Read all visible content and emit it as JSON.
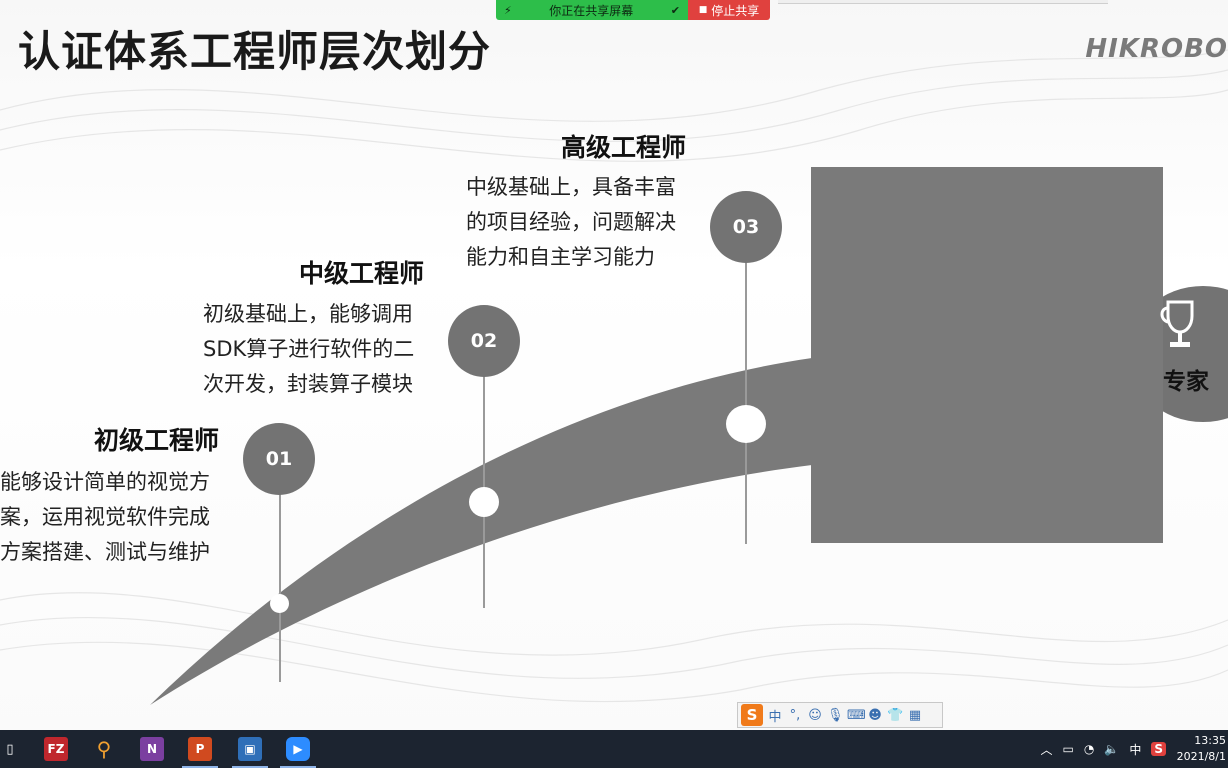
{
  "share_banner": {
    "status_text": "你正在共享屏幕",
    "stop_label": "停止共享"
  },
  "slide": {
    "title": "认证体系工程师层次划分",
    "logo": "HIKROBO",
    "levels": [
      {
        "number": "01",
        "title": "初级工程师",
        "desc": [
          "能够设计简单的视觉方",
          "案，运用视觉软件完成",
          "方案搭建、测试与维护"
        ]
      },
      {
        "number": "02",
        "title": "中级工程师",
        "desc": [
          "初级基础上，能够调用",
          "SDK算子进行软件的二",
          "次开发，封装算子模块"
        ]
      },
      {
        "number": "03",
        "title": "高级工程师",
        "desc": [
          "中级基础上，具备丰富",
          "的项目经验，问题解决",
          "能力和自主学习能力"
        ]
      }
    ],
    "expert_label": "专家"
  },
  "ime": {
    "lang": "中",
    "punct": "°,"
  },
  "taskbar": {
    "apps": [
      {
        "name": "filezilla",
        "label": "FZ",
        "color": "#c0272d"
      },
      {
        "name": "search",
        "label": "⚲",
        "color": "#1c2430"
      },
      {
        "name": "onenote",
        "label": "N",
        "color": "#7b3fa0"
      },
      {
        "name": "powerpoint",
        "label": "P",
        "color": "#d04a1f"
      },
      {
        "name": "remote-desktop",
        "label": "▣",
        "color": "#2f6fb8"
      },
      {
        "name": "zoom",
        "label": "▶",
        "color": "#2d8cff"
      }
    ],
    "tray_lang": "中",
    "time": "13:35",
    "date": "2021/8/1"
  }
}
